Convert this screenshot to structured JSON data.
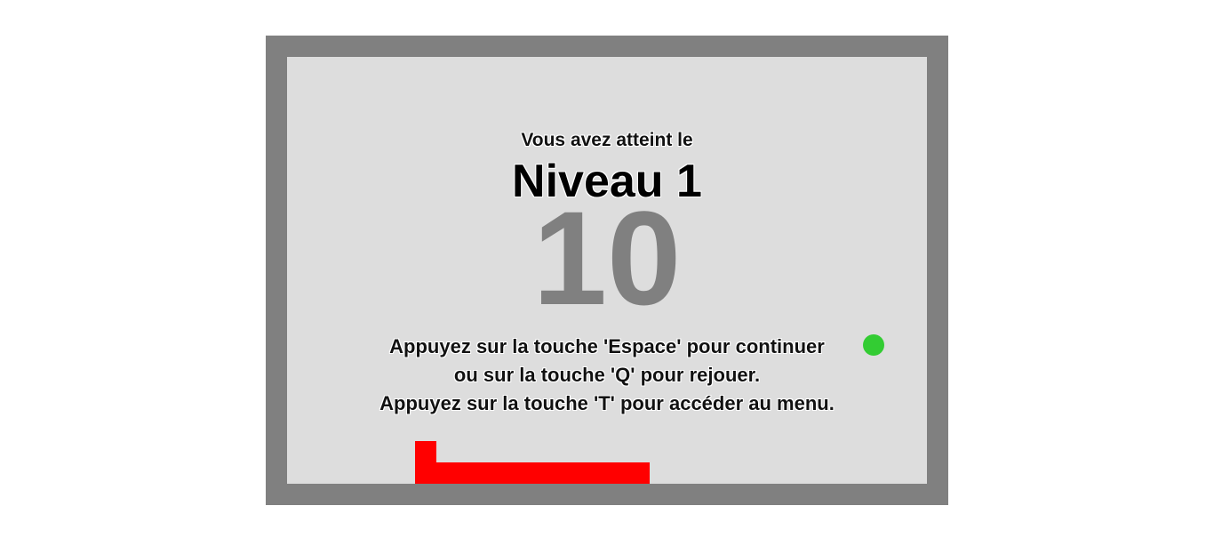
{
  "overlay": {
    "reached_text": "Vous avez atteint le",
    "level_label": "Niveau 1",
    "score": "10",
    "instructions": [
      "Appuyez sur la touche 'Espace' pour continuer",
      "ou sur la touche 'Q' pour rejouer.",
      "Appuyez sur la touche 'T' pour accéder au menu."
    ]
  },
  "colors": {
    "border": "#808080",
    "board": "#dddddd",
    "snake": "#ff0000",
    "food": "#33cc33",
    "score": "#808080"
  }
}
